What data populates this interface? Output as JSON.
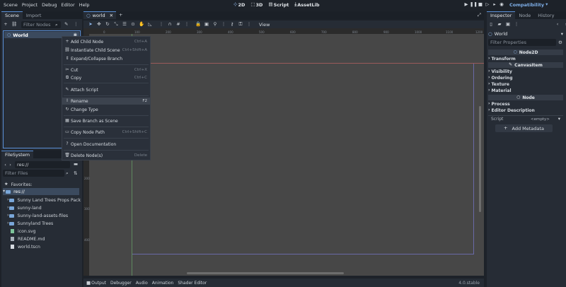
{
  "menu": [
    "Scene",
    "Project",
    "Debug",
    "Editor",
    "Help"
  ],
  "modes": [
    {
      "icon": "2d-icon",
      "glyph": "⊹",
      "label": "2D"
    },
    {
      "icon": "3d-icon",
      "glyph": "⬚",
      "label": "3D"
    },
    {
      "icon": "script-icon",
      "glyph": "▤",
      "label": "Script"
    },
    {
      "icon": "assetlib-icon",
      "glyph": "⤓",
      "label": "AssetLib"
    }
  ],
  "renderer": "Compatibility",
  "scene_panel": {
    "tabs": [
      "Scene",
      "Import"
    ],
    "filter_placeholder": "Filter Nodes",
    "root_node": "World"
  },
  "editor_tabs": {
    "active": "world",
    "close": "✕",
    "add": "+"
  },
  "toolbar": {
    "view_label": "View"
  },
  "ruler_x": [
    "0",
    "100",
    "200",
    "300",
    "400",
    "500",
    "600",
    "700",
    "800",
    "900",
    "1000",
    "1100",
    "1200"
  ],
  "ruler_y": [
    "100",
    "200",
    "300",
    "400"
  ],
  "context_menu": [
    {
      "glyph": "+",
      "label": "Add Child Node",
      "shortcut": "Ctrl+A"
    },
    {
      "glyph": "⛓",
      "label": "Instantiate Child Scene",
      "shortcut": "Ctrl+Shift+A"
    },
    {
      "glyph": "⇕",
      "label": "Expand/Collapse Branch",
      "shortcut": ""
    },
    {
      "glyph": "✂",
      "label": "Cut",
      "shortcut": "Ctrl+X"
    },
    {
      "glyph": "⧉",
      "label": "Copy",
      "shortcut": "Ctrl+C"
    },
    {
      "glyph": "✎",
      "label": "Attach Script",
      "shortcut": ""
    },
    {
      "glyph": "I",
      "label": "Rename",
      "shortcut": "F2"
    },
    {
      "glyph": "↻",
      "label": "Change Type",
      "shortcut": ""
    },
    {
      "glyph": "▦",
      "label": "Save Branch as Scene",
      "shortcut": ""
    },
    {
      "glyph": "▭",
      "label": "Copy Node Path",
      "shortcut": "Ctrl+Shift+C"
    },
    {
      "glyph": "?",
      "label": "Open Documentation",
      "shortcut": ""
    },
    {
      "glyph": "🗑",
      "label": "Delete Node(s)",
      "shortcut": "Delete"
    }
  ],
  "filesystem": {
    "tab": "FileSystem",
    "path": "res://",
    "filter_placeholder": "Filter Files",
    "favorites": "Favorites:",
    "root": "res://",
    "items": [
      {
        "type": "folder",
        "name": "Sunny Land Trees Props Pack"
      },
      {
        "type": "folder",
        "name": "sunny-land"
      },
      {
        "type": "folder",
        "name": "Sunny-land-assets-files"
      },
      {
        "type": "folder",
        "name": "Sunnyland Trees"
      },
      {
        "type": "file",
        "name": "icon.svg"
      },
      {
        "type": "file",
        "name": "README.md"
      },
      {
        "type": "file",
        "name": "world.tscn"
      }
    ]
  },
  "inspector": {
    "tabs": [
      "Inspector",
      "Node",
      "History"
    ],
    "node_name": "World",
    "filter_placeholder": "Filter Properties",
    "class_node2d": "Node2D",
    "transform": "Transform",
    "class_canvasitem": "CanvasItem",
    "canvas_sections": [
      "Visibility",
      "Ordering",
      "Texture",
      "Material"
    ],
    "class_node": "Node",
    "node_sections": [
      "Process",
      "Editor Description"
    ],
    "script_label": "Script",
    "script_value": "<empty>",
    "add_metadata": "Add Metadata"
  },
  "bottom_panel": {
    "tabs": [
      "Output",
      "Debugger",
      "Audio",
      "Animation",
      "Shader Editor"
    ],
    "version": "4.0.stable"
  },
  "colors": {
    "accent": "#5a8fd6",
    "viewport": "#474747",
    "bg": "#1d2229"
  }
}
